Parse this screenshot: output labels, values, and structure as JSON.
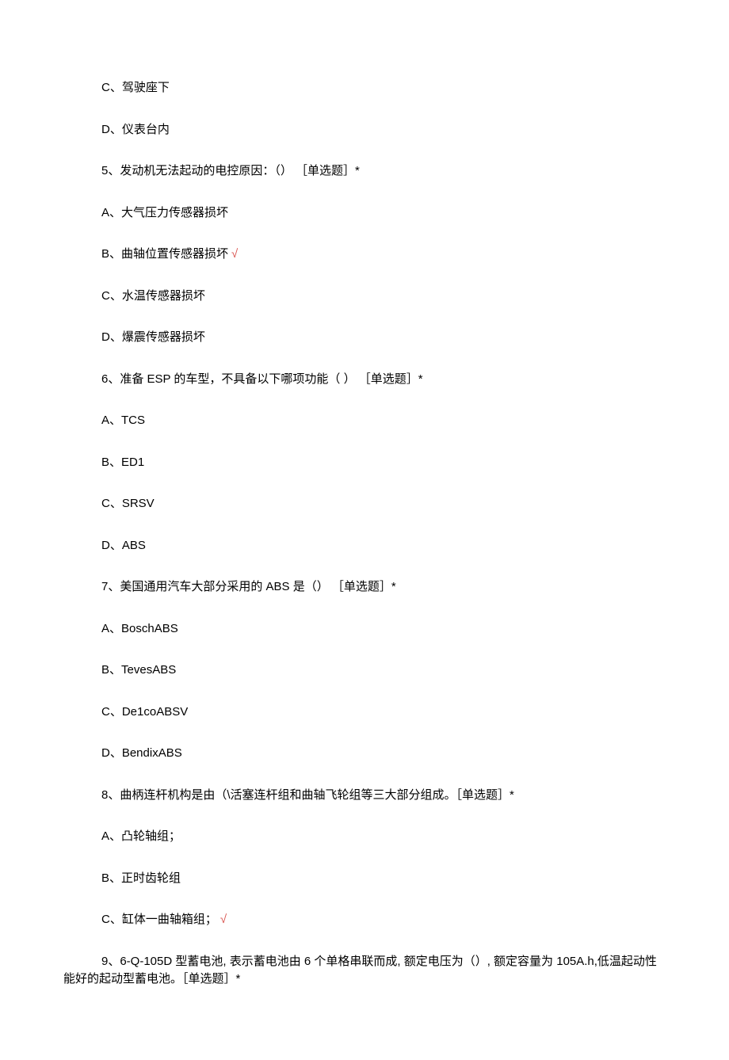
{
  "items": [
    {
      "text": "C、驾驶座下",
      "indent": true,
      "check": false
    },
    {
      "text": "D、仪表台内",
      "indent": true,
      "check": false
    },
    {
      "text": "5、发动机无法起动的电控原因：（） ［单选题］*",
      "indent": true,
      "check": false
    },
    {
      "text": "A、大气压力传感器损坏",
      "indent": true,
      "check": false
    },
    {
      "text": "B、曲轴位置传感器损坏",
      "indent": true,
      "check": true
    },
    {
      "text": "C、水温传感器损坏",
      "indent": true,
      "check": false
    },
    {
      "text": "D、爆震传感器损坏",
      "indent": true,
      "check": false
    },
    {
      "text": "6、准备 ESP 的车型，不具备以下哪项功能（ ） ［单选题］*",
      "indent": true,
      "check": false
    },
    {
      "text": "A、TCS",
      "indent": true,
      "check": false
    },
    {
      "text": "B、ED1",
      "indent": true,
      "check": false
    },
    {
      "text": "C、SRSV",
      "indent": true,
      "check": false
    },
    {
      "text": "D、ABS",
      "indent": true,
      "check": false
    },
    {
      "text": "7、美国通用汽车大部分采用的 ABS 是（） ［单选题］*",
      "indent": true,
      "check": false
    },
    {
      "text": "A、BoschABS",
      "indent": true,
      "check": false
    },
    {
      "text": "B、TevesABS",
      "indent": true,
      "check": false
    },
    {
      "text": "C、De1coABSV",
      "indent": true,
      "check": false
    },
    {
      "text": "D、BendixABS",
      "indent": true,
      "check": false
    },
    {
      "text": "8、曲柄连杆机构是由（\\活塞连杆组和曲轴飞轮组等三大部分组成。［单选题］*",
      "indent": true,
      "check": false
    },
    {
      "text": "A、凸轮轴组；",
      "indent": true,
      "check": false
    },
    {
      "text": "B、正时齿轮组",
      "indent": true,
      "check": false
    },
    {
      "text": "C、缸体一曲轴箱组；",
      "indent": true,
      "check": true
    },
    {
      "text": "9、6-Q-105D 型蓄电池, 表示蓄电池由 6 个单格串联而成, 额定电压为（）, 额定容量为 105A.h,低温起动性能好的起动型蓄电池。［单选题］*",
      "indent": false,
      "check": false
    }
  ],
  "checkmark_symbol": "√"
}
